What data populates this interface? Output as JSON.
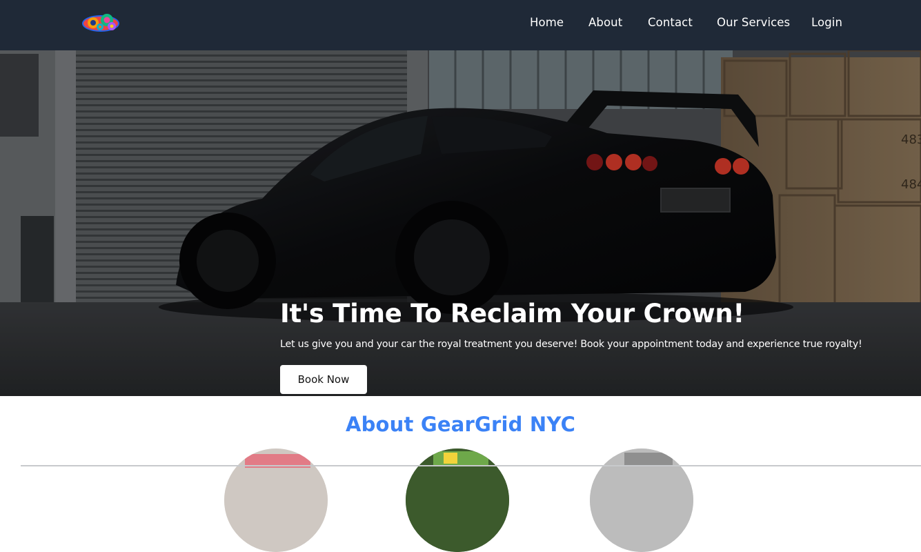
{
  "nav": {
    "logo_icon": "colorful-gears-logo",
    "links": [
      "Home",
      "About",
      "Contact",
      "Our Services",
      "Login"
    ]
  },
  "hero": {
    "title": "It's Time To Reclaim Your Crown!",
    "subtitle": "Let us give you and your car the royal treatment you deserve! Book your appointment today and experience true royalty!",
    "button_label": "Book Now"
  },
  "about": {
    "title": "About GearGrid NYC"
  },
  "colors": {
    "navbar": "#1f2937",
    "accent": "#3b82f6",
    "text_light": "#ffffff"
  }
}
